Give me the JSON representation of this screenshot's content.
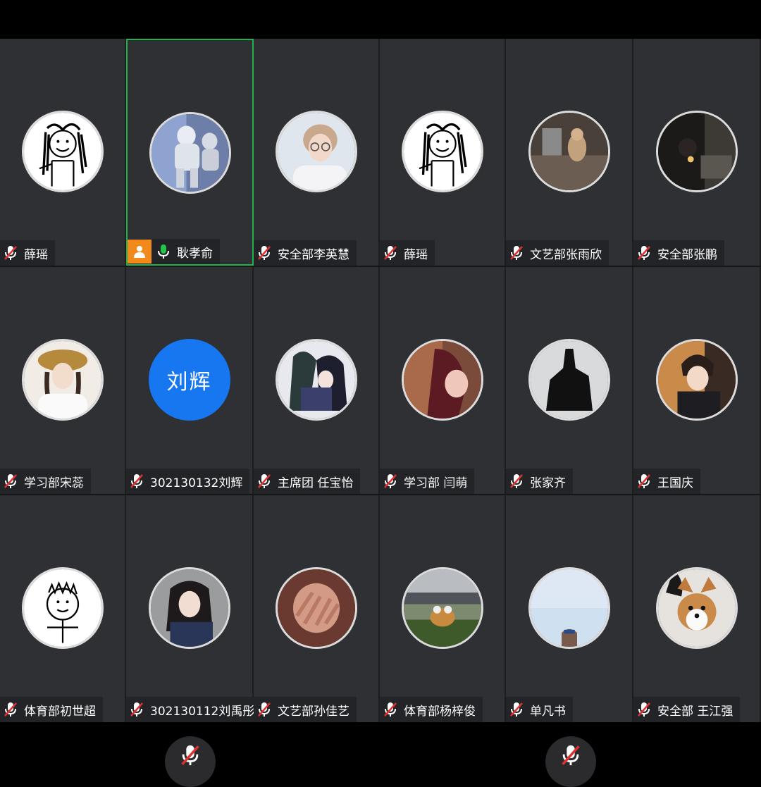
{
  "participants": [
    {
      "name": "薛瑶",
      "mic": "muted",
      "avatar": "doodle-girl-icon"
    },
    {
      "name": "耿孝俞",
      "mic": "on",
      "avatar": "astronaut-photo",
      "host": true
    },
    {
      "name": "安全部李英慧",
      "mic": "muted",
      "avatar": "boy-glasses-photo"
    },
    {
      "name": "薛瑶",
      "mic": "muted",
      "avatar": "doodle-girl-icon"
    },
    {
      "name": "文艺部张雨欣",
      "mic": "muted",
      "avatar": "cat-photo"
    },
    {
      "name": "安全部张鹏",
      "mic": "muted",
      "avatar": "night-street-photo"
    },
    {
      "name": "学习部宋蕊",
      "mic": "muted",
      "avatar": "girl-hat-photo"
    },
    {
      "name": "302130132刘辉",
      "mic": "muted",
      "avatar_text": "刘辉"
    },
    {
      "name": "主席团 任宝怡",
      "mic": "muted",
      "avatar": "anime-photo"
    },
    {
      "name": "学习部 闫萌",
      "mic": "muted",
      "avatar": "girl-red-hair-photo"
    },
    {
      "name": "张家齐",
      "mic": "muted",
      "avatar": "silhouette-photo"
    },
    {
      "name": "王国庆",
      "mic": "muted",
      "avatar": "anime-boy-photo"
    },
    {
      "name": "体育部初世超",
      "mic": "muted",
      "avatar": "doodle-boy-icon"
    },
    {
      "name": "302130112刘禹彤",
      "mic": "muted",
      "avatar": "girl-portrait-photo"
    },
    {
      "name": "文艺部孙佳艺",
      "mic": "muted",
      "avatar": "hands-face-photo"
    },
    {
      "name": "体育部杨梓俊",
      "mic": "muted",
      "avatar": "dog-car-photo"
    },
    {
      "name": "单凡书",
      "mic": "muted",
      "avatar": "sky-tower-photo"
    },
    {
      "name": "安全部 王江强",
      "mic": "muted",
      "avatar": "corgi-photo"
    }
  ],
  "colors": {
    "tile_bg": "#2f3033",
    "active_border": "#21b24a",
    "host_badge": "#f18a1a",
    "text_avatar_bg": "#1677f0",
    "mic_on": "#23c24b",
    "mic_muted": "#e03131"
  },
  "controls": [
    {
      "name": "mute-toggle",
      "icon": "mic-muted-icon"
    },
    {
      "name": "mute-toggle-2",
      "icon": "mic-muted-icon"
    }
  ]
}
